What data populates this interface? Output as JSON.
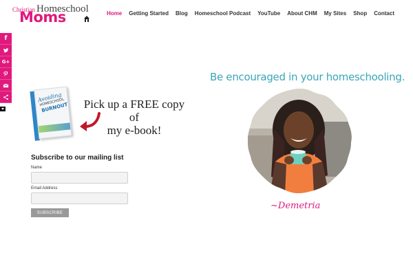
{
  "brand": {
    "line1_small": "Christian",
    "line1_large": "Homeschool",
    "line2": "Moms",
    "accent": "#e0197d",
    "teal": "#3aa6b9"
  },
  "nav": {
    "items": [
      {
        "label": "Home"
      },
      {
        "label": "Getting Started"
      },
      {
        "label": "Blog"
      },
      {
        "label": "Homeschool Podcast"
      },
      {
        "label": "YouTube"
      },
      {
        "label": "About CHM"
      },
      {
        "label": "My Sites"
      },
      {
        "label": "Shop"
      },
      {
        "label": "Contact"
      }
    ],
    "active": "Home"
  },
  "social": {
    "buttons": [
      {
        "icon": "facebook-icon",
        "glyph": "f"
      },
      {
        "icon": "twitter-icon"
      },
      {
        "icon": "google-plus-icon",
        "glyph": "G+"
      },
      {
        "icon": "pinterest-icon"
      },
      {
        "icon": "email-icon"
      },
      {
        "icon": "share-icon"
      }
    ]
  },
  "ebook": {
    "cover_title_line1": "Avoiding",
    "cover_title_line2": "HOMESCHOOL",
    "cover_title_line3": "BURNOUT",
    "promo_line1": "Pick up a FREE copy of",
    "promo_line2": "my e-book!"
  },
  "subscribe": {
    "title": "Subscribe to our mailing list",
    "name_label": "Name",
    "name_value": "",
    "email_label": "Email Address",
    "email_value": "",
    "button_label": "SUBSCRIBE"
  },
  "hero": {
    "tagline": "Be encouraged in your homeschooling.",
    "signature": "~Demetria"
  }
}
